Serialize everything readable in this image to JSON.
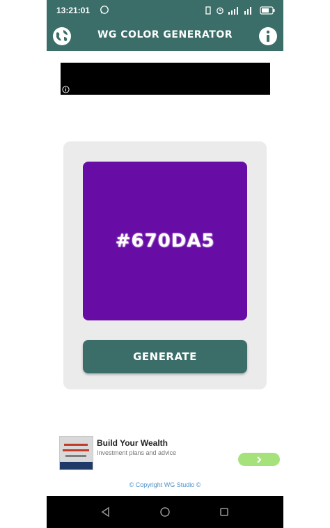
{
  "status_bar": {
    "time": "13:21:01",
    "icons": [
      "whatsapp-icon",
      "vibrate-icon",
      "alarm-icon",
      "signal-icon",
      "wifi-signal-icon",
      "battery-icon"
    ]
  },
  "app_bar": {
    "title": "WG COLOR GENERATOR",
    "left_icon": "globe-icon",
    "right_icon": "info-icon"
  },
  "color_card": {
    "hex_value": "#670DA5",
    "swatch_color": "#670DA5",
    "generate_label": "GENERATE"
  },
  "native_ad": {
    "headline": "Build Your Wealth",
    "body": "Investment plans and advice"
  },
  "footer": {
    "copyright": "© Copyright WG Studio ©"
  },
  "colors": {
    "primary": "#3b6e69",
    "card_bg": "#ebebeb",
    "cta_green": "#a6e27c"
  }
}
